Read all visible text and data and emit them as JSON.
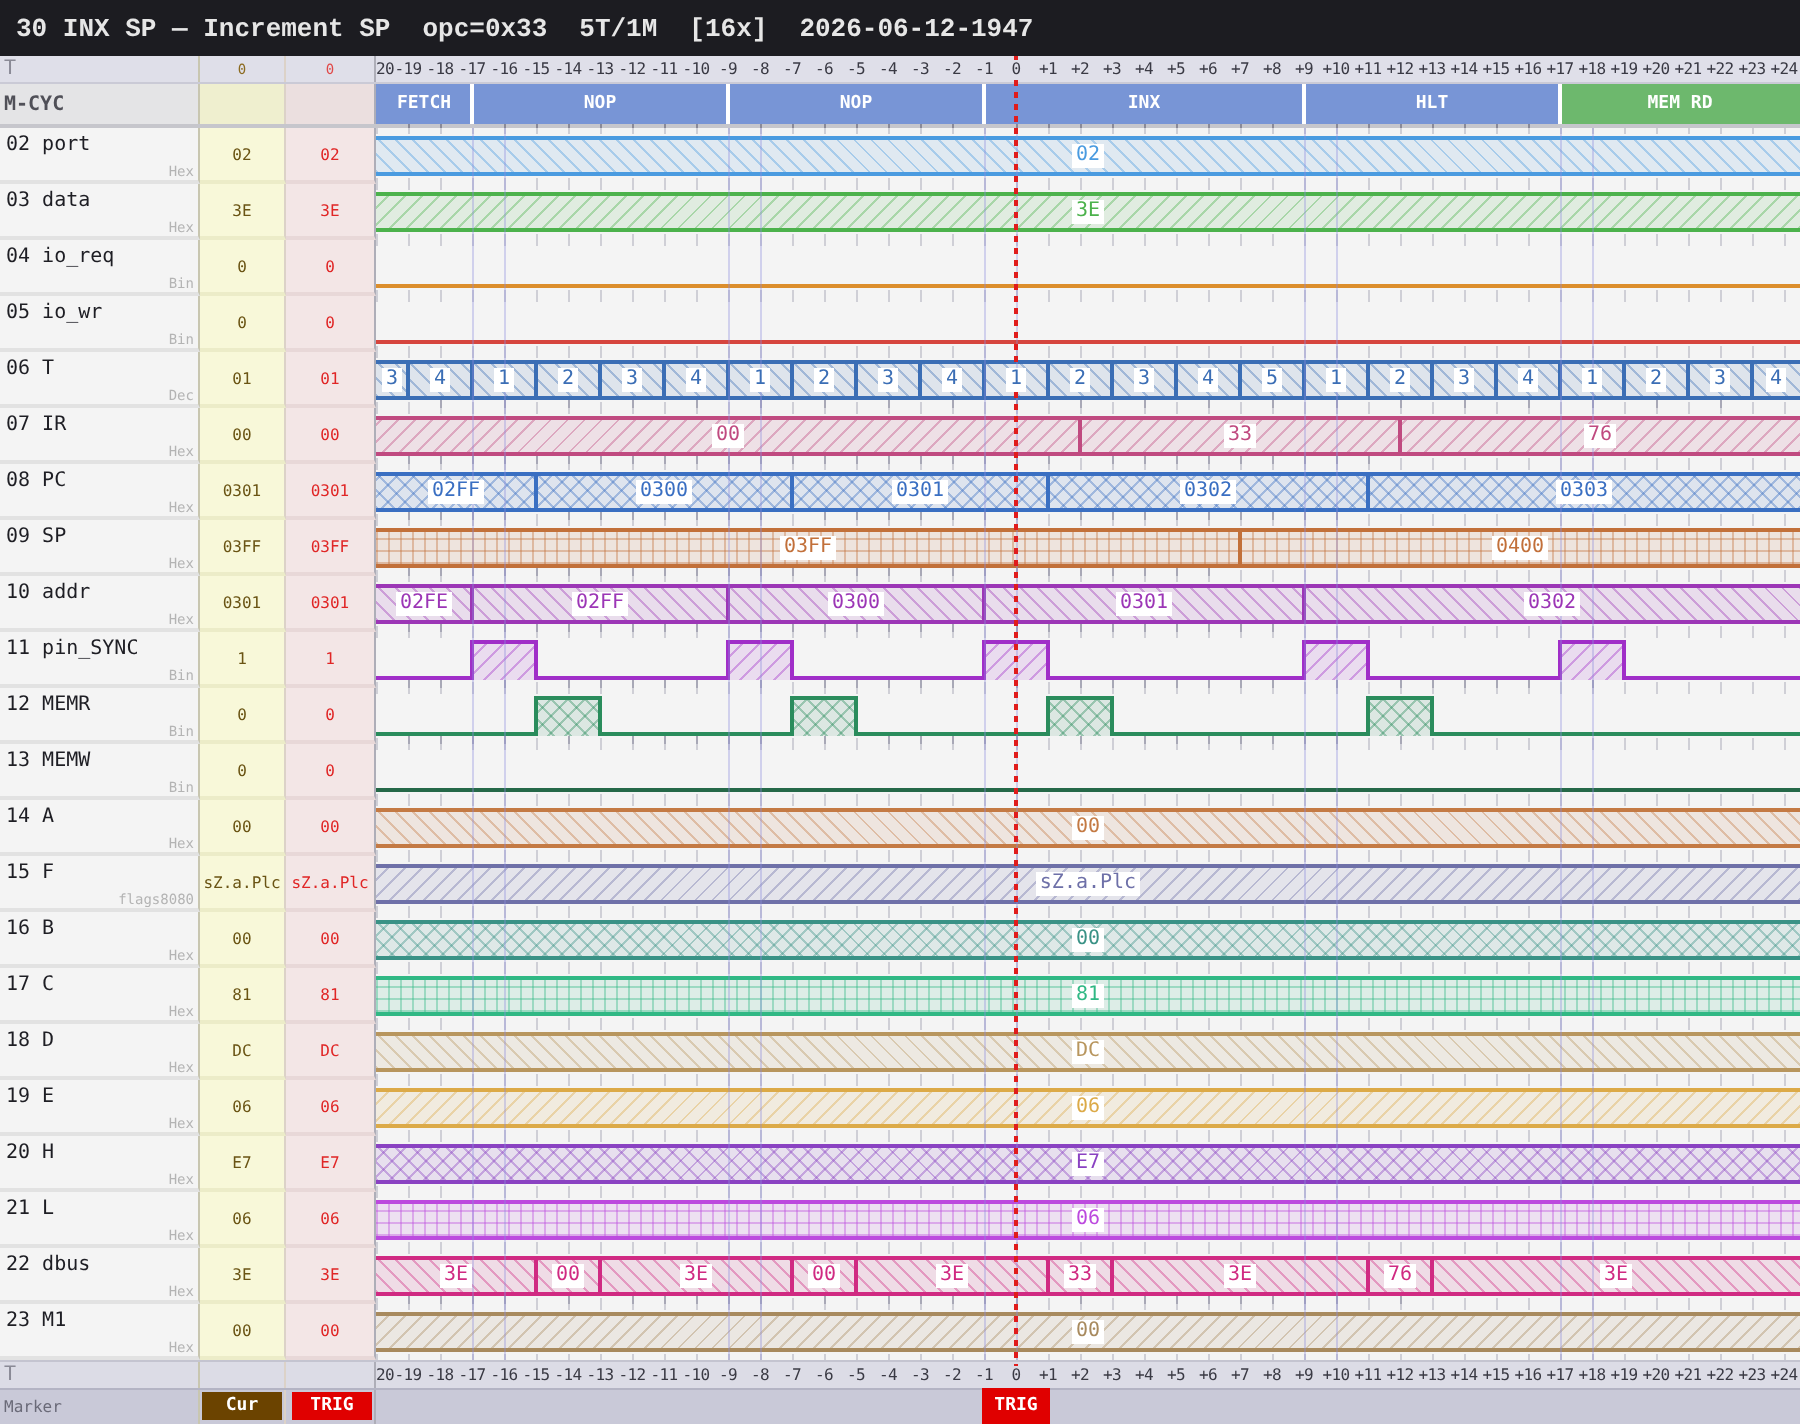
{
  "title": [
    "30 INX SP — Increment SP",
    "opc=0x33",
    "5T/1M",
    "[16x]",
    "2026-06-12-1947"
  ],
  "header_row": {
    "label": "T",
    "cur": "0",
    "trig": "0",
    "ruler": [
      {
        "label": "20",
        "trigger": false
      },
      {
        "label": "-19",
        "trigger": false
      },
      {
        "label": "-18",
        "trigger": false
      },
      {
        "label": "-17",
        "trigger": false
      },
      {
        "label": "-16",
        "trigger": false
      },
      {
        "label": "-15",
        "trigger": false
      },
      {
        "label": "-14",
        "trigger": false
      },
      {
        "label": "-13",
        "trigger": false
      },
      {
        "label": "-12",
        "trigger": false
      },
      {
        "label": "-11",
        "trigger": false
      },
      {
        "label": "-10",
        "trigger": false
      },
      {
        "label": "-9",
        "trigger": false
      },
      {
        "label": "-8",
        "trigger": false
      },
      {
        "label": "-7",
        "trigger": false
      },
      {
        "label": "-6",
        "trigger": false
      },
      {
        "label": "-5",
        "trigger": false
      },
      {
        "label": "-4",
        "trigger": false
      },
      {
        "label": "-3",
        "trigger": false
      },
      {
        "label": "-2",
        "trigger": false
      },
      {
        "label": "-1",
        "trigger": false
      },
      {
        "label": "0",
        "trigger": true
      },
      {
        "label": "+1",
        "trigger": false
      },
      {
        "label": "+2",
        "trigger": false
      },
      {
        "label": "+3",
        "trigger": false
      },
      {
        "label": "+4",
        "trigger": false
      },
      {
        "label": "+5",
        "trigger": false
      },
      {
        "label": "+6",
        "trigger": false
      },
      {
        "label": "+7",
        "trigger": false
      },
      {
        "label": "+8",
        "trigger": false
      },
      {
        "label": "+9",
        "trigger": false
      },
      {
        "label": "+10",
        "trigger": false
      },
      {
        "label": "+11",
        "trigger": false
      },
      {
        "label": "+12",
        "trigger": false
      },
      {
        "label": "+13",
        "trigger": false
      },
      {
        "label": "+14",
        "trigger": false
      },
      {
        "label": "+15",
        "trigger": false
      },
      {
        "label": "+16",
        "trigger": false
      },
      {
        "label": "+17",
        "trigger": false
      },
      {
        "label": "+18",
        "trigger": false
      },
      {
        "label": "+19",
        "trigger": false
      },
      {
        "label": "+20",
        "trigger": false
      },
      {
        "label": "+21",
        "trigger": false
      },
      {
        "label": "+22",
        "trigger": false
      },
      {
        "label": "+23",
        "trigger": false
      },
      {
        "label": "+24",
        "trigger": false
      }
    ]
  },
  "mcycle": {
    "label": "M-CYC",
    "boundaries": [
      false,
      false,
      true,
      false,
      false,
      false,
      false,
      false,
      false,
      false,
      true,
      false,
      false,
      false,
      false,
      false,
      false,
      false,
      true,
      false,
      false,
      false,
      false,
      false,
      false,
      false,
      false,
      false,
      true,
      false,
      false,
      false,
      false,
      false,
      false,
      false,
      true
    ],
    "segments": [
      {
        "label": "FETCH",
        "color": "#7895d6"
      },
      {
        "label": "NOP",
        "color": "#7895d6"
      },
      {
        "label": "NOP",
        "color": "#7895d6"
      },
      {
        "label": "INX",
        "color": "#7895d6"
      },
      {
        "label": "HLT",
        "color": "#7895d6"
      },
      {
        "label": "MEM RD",
        "color": "#6db86d"
      }
    ]
  },
  "signals": [
    {
      "name": "02 port",
      "format": "Hex",
      "cur": "02",
      "trig": "02",
      "kind": "bus",
      "color": "#4a9be0",
      "data": [
        "02"
      ]
    },
    {
      "name": "03 data",
      "format": "Hex",
      "cur": "3E",
      "trig": "3E",
      "kind": "bus",
      "color": "#4cb24c",
      "data": [
        "3E"
      ]
    },
    {
      "name": "04 io_req",
      "format": "Bin",
      "cur": "0",
      "trig": "0",
      "kind": "bit",
      "color": "#dc8e2c",
      "high": false
    },
    {
      "name": "05 io_wr",
      "format": "Bin",
      "cur": "0",
      "trig": "0",
      "kind": "bit",
      "color": "#d6453e",
      "high": false
    },
    {
      "name": "06 T",
      "format": "Dec",
      "cur": "01",
      "trig": "01",
      "kind": "bus",
      "color": "#3b6eb5",
      "boundaries": [
        true,
        false,
        true,
        false,
        true,
        false,
        true,
        false,
        true,
        false,
        true,
        false,
        true,
        false,
        true,
        false,
        true,
        false,
        true,
        false,
        true,
        false,
        true,
        false,
        true,
        false,
        true,
        false,
        true,
        false,
        true,
        false,
        true,
        false,
        true,
        false,
        true,
        false,
        true,
        false,
        true,
        false,
        true
      ],
      "data": [
        "3",
        "4",
        "1",
        "2",
        "3",
        "4",
        "1",
        "2",
        "3",
        "4",
        "1",
        "2",
        "3",
        "4",
        "5",
        "1",
        "2",
        "3",
        "4",
        "1",
        "2",
        "3",
        "4"
      ]
    },
    {
      "name": "07 IR",
      "format": "Hex",
      "cur": "00",
      "trig": "00",
      "kind": "bus",
      "color": "#c04a80",
      "boundaries": [
        false,
        false,
        false,
        false,
        false,
        false,
        false,
        false,
        false,
        false,
        false,
        false,
        false,
        false,
        false,
        false,
        false,
        false,
        false,
        false,
        false,
        true,
        false,
        false,
        false,
        false,
        false,
        false,
        false,
        false,
        false,
        true
      ],
      "data": [
        "00",
        "33",
        "76"
      ]
    },
    {
      "name": "08 PC",
      "format": "Hex",
      "cur": "0301",
      "trig": "0301",
      "kind": "bus",
      "color": "#3a6fc2",
      "boundaries": [
        false,
        false,
        false,
        false,
        true,
        false,
        false,
        false,
        false,
        false,
        false,
        false,
        true,
        false,
        false,
        false,
        false,
        false,
        false,
        false,
        true,
        false,
        false,
        false,
        false,
        false,
        false,
        false,
        false,
        false,
        true
      ],
      "data": [
        "02FF",
        "0300",
        "0301",
        "0302",
        "0303"
      ]
    },
    {
      "name": "09 SP",
      "format": "Hex",
      "cur": "03FF",
      "trig": "03FF",
      "kind": "bus",
      "color": "#c2703a",
      "boundaries": [
        false,
        false,
        false,
        false,
        false,
        false,
        false,
        false,
        false,
        false,
        false,
        false,
        false,
        false,
        false,
        false,
        false,
        false,
        false,
        false,
        false,
        false,
        false,
        false,
        false,
        false,
        true
      ],
      "data": [
        "03FF",
        "0400"
      ]
    },
    {
      "name": "10 addr",
      "format": "Hex",
      "cur": "0301",
      "trig": "0301",
      "kind": "bus",
      "color": "#9c36b6",
      "boundaries": [
        false,
        false,
        true,
        false,
        false,
        false,
        false,
        false,
        false,
        false,
        true,
        false,
        false,
        false,
        false,
        false,
        false,
        false,
        true,
        false,
        false,
        false,
        false,
        false,
        false,
        false,
        false,
        false,
        true
      ],
      "data": [
        "02FE",
        "02FF",
        "0300",
        "0301",
        "0302"
      ]
    },
    {
      "name": "11 pin_SYNC",
      "format": "Bin",
      "cur": "1",
      "trig": "1",
      "kind": "bit",
      "color": "#a02ec8",
      "high": false,
      "edges": [
        false,
        false,
        true,
        false,
        true,
        false,
        false,
        false,
        false,
        false,
        true,
        false,
        true,
        false,
        false,
        false,
        false,
        false,
        true,
        false,
        true,
        false,
        false,
        false,
        false,
        false,
        false,
        false,
        true,
        false,
        true,
        false,
        false,
        false,
        false,
        false,
        true,
        false,
        true
      ]
    },
    {
      "name": "12 MEMR",
      "format": "Bin",
      "cur": "0",
      "trig": "0",
      "kind": "bit",
      "color": "#2a8c5c",
      "high": false,
      "edges": [
        false,
        false,
        false,
        false,
        true,
        false,
        true,
        false,
        false,
        false,
        false,
        false,
        true,
        false,
        true,
        false,
        false,
        false,
        false,
        false,
        true,
        false,
        true,
        false,
        false,
        false,
        false,
        false,
        false,
        false,
        true,
        false,
        true
      ]
    },
    {
      "name": "13 MEMW",
      "format": "Bin",
      "cur": "0",
      "trig": "0",
      "kind": "bit",
      "color": "#256848",
      "high": false
    },
    {
      "name": "14 A",
      "format": "Hex",
      "cur": "00",
      "trig": "00",
      "kind": "bus",
      "color": "#c47a44",
      "data": [
        "00"
      ]
    },
    {
      "name": "15 F",
      "format": "flags8080",
      "cur": "sZ.a.Plc",
      "trig": "sZ.a.Plc",
      "kind": "bus",
      "color": "#6e70a8",
      "data": [
        "sZ.a.Plc"
      ]
    },
    {
      "name": "16 B",
      "format": "Hex",
      "cur": "00",
      "trig": "00",
      "kind": "bus",
      "color": "#3a9286",
      "data": [
        "00"
      ]
    },
    {
      "name": "17 C",
      "format": "Hex",
      "cur": "81",
      "trig": "81",
      "kind": "bus",
      "color": "#30b884",
      "data": [
        "81"
      ]
    },
    {
      "name": "18 D",
      "format": "Hex",
      "cur": "DC",
      "trig": "DC",
      "kind": "bus",
      "color": "#b8965e",
      "data": [
        "DC"
      ]
    },
    {
      "name": "19 E",
      "format": "Hex",
      "cur": "06",
      "trig": "06",
      "kind": "bus",
      "color": "#dcaa48",
      "data": [
        "06"
      ]
    },
    {
      "name": "20 H",
      "format": "Hex",
      "cur": "E7",
      "trig": "E7",
      "kind": "bus",
      "color": "#8a42c2",
      "data": [
        "E7"
      ]
    },
    {
      "name": "21 L",
      "format": "Hex",
      "cur": "06",
      "trig": "06",
      "kind": "bus",
      "color": "#bc4ade",
      "data": [
        "06"
      ]
    },
    {
      "name": "22 dbus",
      "format": "Hex",
      "cur": "3E",
      "trig": "3E",
      "kind": "bus",
      "color": "#d02a82",
      "boundaries": [
        false,
        false,
        false,
        false,
        true,
        false,
        true,
        false,
        false,
        false,
        false,
        false,
        true,
        false,
        true,
        false,
        false,
        false,
        false,
        false,
        true,
        false,
        true,
        false,
        false,
        false,
        false,
        false,
        false,
        false,
        true,
        false,
        true
      ],
      "data": [
        "3E",
        "00",
        "3E",
        "00",
        "3E",
        "33",
        "3E",
        "76",
        "3E"
      ]
    },
    {
      "name": "23 M1",
      "format": "Hex",
      "cur": "00",
      "trig": "00",
      "kind": "bus",
      "color": "#a88a5e",
      "data": [
        "00"
      ]
    }
  ],
  "footer_row": {
    "label": "T",
    "ruler": [
      "20",
      "-19",
      "-18",
      "-17",
      "-16",
      "-15",
      "-14",
      "-13",
      "-12",
      "-11",
      "-10",
      "-9",
      "-8",
      "-7",
      "-6",
      "-5",
      "-4",
      "-3",
      "-2",
      "-1",
      "0",
      "+1",
      "+2",
      "+3",
      "+4",
      "+5",
      "+6",
      "+7",
      "+8",
      "+9",
      "+10",
      "+11",
      "+12",
      "+13",
      "+14",
      "+15",
      "+16",
      "+17",
      "+18",
      "+19",
      "+20",
      "+21",
      "+22",
      "+23",
      "+24"
    ]
  },
  "marker_row": {
    "label": "Marker",
    "cursor_marker": "Cur",
    "trigger_marker": "TRIG",
    "trigger_flag": "TRIG"
  }
}
